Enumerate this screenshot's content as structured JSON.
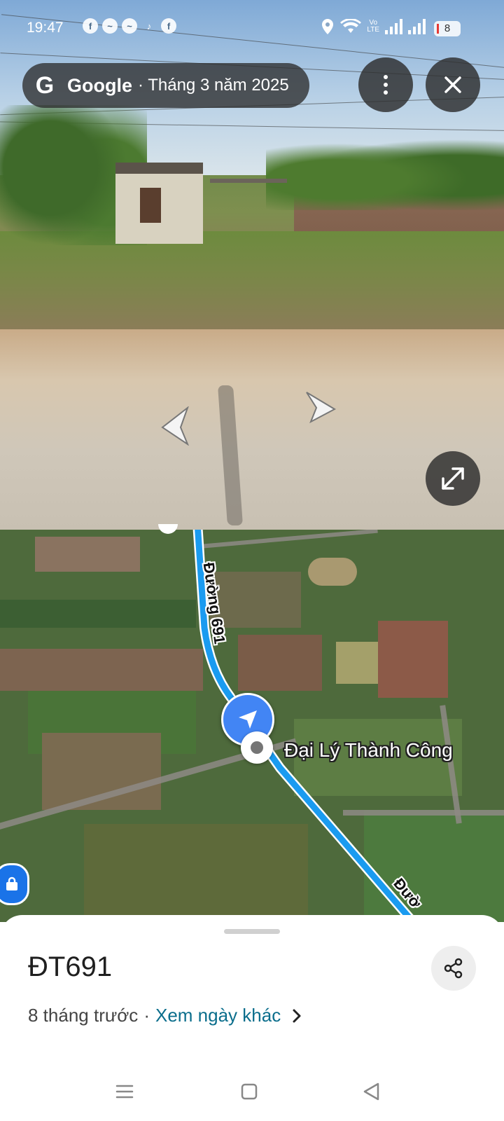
{
  "status_bar": {
    "time": "19:47",
    "lte_label": "Vo\nLTE",
    "battery": "8",
    "app_icons": [
      "facebook-icon",
      "messenger-icon",
      "messenger-icon",
      "tiktok-icon",
      "facebook-icon"
    ]
  },
  "streetview": {
    "brand": "Google",
    "date_label": "· Tháng 3 năm 2025"
  },
  "map": {
    "road_label_top": "Đường 691",
    "road_label_bottom": "Đườ",
    "place_label": "Đại Lý Thành Công",
    "route_color": "#1a9bf0"
  },
  "sheet": {
    "title": "ĐT691",
    "age_text": "8 tháng trước",
    "separator": "·",
    "other_dates_link": "Xem ngày khác"
  },
  "colors": {
    "accent": "#4285f4",
    "link": "#0b6e8c",
    "pill_bg": "#2d2d2d"
  }
}
